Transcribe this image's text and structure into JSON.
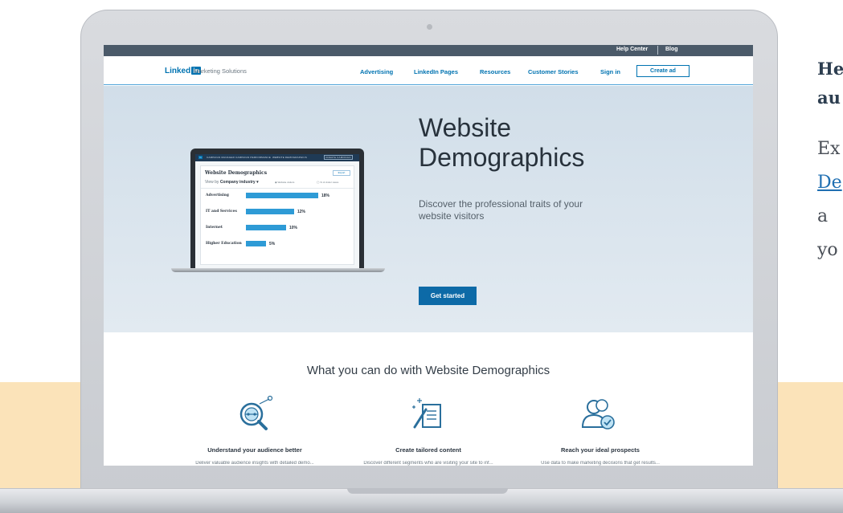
{
  "side": {
    "heading_line1": "He",
    "heading_line2": "au",
    "body_line1": "Ex",
    "body_link": "De",
    "body_line3": "a",
    "body_line4": "yo"
  },
  "topbar": {
    "help_center": "Help Center",
    "blog": "Blog"
  },
  "navbar": {
    "logo_text": "Linked",
    "logo_in": "in",
    "logo_sub": "Marketing Solutions",
    "links": [
      "Advertising",
      "LinkedIn Pages",
      "Resources",
      "Customer Stories",
      "Sign in"
    ],
    "create_ad": "Create ad"
  },
  "hero": {
    "title": "Website Demographics",
    "subtitle": "Discover the professional traits of your website visitors",
    "cta": "Get started"
  },
  "mockup": {
    "nav_items": [
      "CAMPAIGN MANAGER",
      "CAMPAIGN PERFORMANCE",
      "WEBSITE DEMOGRAPHICS",
      "CREATE CAMPAIGN"
    ],
    "title": "Website Demographics",
    "export": "Export",
    "view_by_label": "View by",
    "view_by_value": "Company industry ▾",
    "radio1": "◉ Website visitors",
    "radio2": "◯ % of visitor views",
    "rows": [
      {
        "label": "Advertising",
        "value": 18,
        "display": "18%"
      },
      {
        "label": "IT and Services",
        "value": 12,
        "display": "12%"
      },
      {
        "label": "Internet",
        "value": 10,
        "display": "10%"
      },
      {
        "label": "Higher Education",
        "value": 5,
        "display": "5%"
      }
    ]
  },
  "features": {
    "section_title": "What you can do with Website Demographics",
    "items": [
      {
        "label": "Understand your audience better",
        "sub": "Deliver valuable audience insights with detailed demo...",
        "icon": "magnifier-analytics-icon"
      },
      {
        "label": "Create tailored content",
        "sub": "Discover different segments who are visiting your site to inf...",
        "icon": "document-sparkle-icon"
      },
      {
        "label": "Reach your ideal prospects",
        "sub": "Use data to make marketing decisions that get results...",
        "icon": "people-check-icon"
      }
    ]
  },
  "colors": {
    "linkedin_blue": "#0073b1",
    "peach": "#fbe3b9",
    "hero_bg": "#d1dee9",
    "bar_blue": "#2e9bd6"
  }
}
